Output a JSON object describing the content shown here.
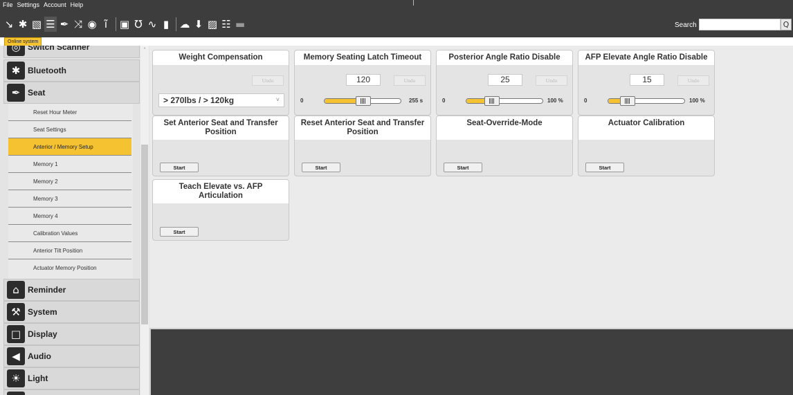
{
  "menu": [
    "File",
    "Settings",
    "Account",
    "Help"
  ],
  "toolbar_icons": [
    "scanner-icon",
    "bluetooth-icon",
    "seat-display-icon",
    "lines-icon",
    "seat-icon",
    "shuffle-icon",
    "camera-icon",
    "remote-icon",
    "monitor-icon",
    "stethoscope-icon",
    "pulse-icon",
    "battery-icon",
    "cloud-icon",
    "download-icon",
    "image-icon",
    "clipboard-icon",
    "chat-icon"
  ],
  "search": {
    "label": "Search",
    "value": "",
    "button": "Q"
  },
  "status": {
    "online_badge": "Online system"
  },
  "sidebar": {
    "categories": [
      {
        "label": "Switch Scanner",
        "icon": "scanner-icon"
      },
      {
        "label": "Bluetooth",
        "icon": "bluetooth-icon"
      },
      {
        "label": "Seat",
        "icon": "seat-icon"
      },
      {
        "label": "Reminder",
        "icon": "bell-icon"
      },
      {
        "label": "System",
        "icon": "wrench-icon"
      },
      {
        "label": "Display",
        "icon": "monitor-icon"
      },
      {
        "label": "Audio",
        "icon": "speaker-icon"
      },
      {
        "label": "Light",
        "icon": "lightbulb-icon"
      }
    ],
    "seat_items": [
      "Reset Hour Meter",
      "Seat Settings",
      "Anterior / Memory Setup",
      "Memory 1",
      "Memory 2",
      "Memory 3",
      "Memory 4",
      "Calibration Values",
      "Anterior Tilt Position",
      "Actuator Memory Position"
    ],
    "selected_item": "Anterior / Memory Setup"
  },
  "cards": {
    "weight": {
      "title": "Weight Compensation",
      "undo": "Undo",
      "select_value": "> 270lbs / > 120kg"
    },
    "latch": {
      "title": "Memory Seating Latch Timeout",
      "value": "120",
      "undo": "Undo",
      "min": "0",
      "max": "255 s",
      "level": 0.47
    },
    "posterior": {
      "title": "Posterior Angle Ratio Disable",
      "value": "25",
      "undo": "Undo",
      "min": "0",
      "max": "100 %",
      "level": 0.25
    },
    "afp": {
      "title": "AFP Elevate Angle Ratio Disable",
      "value": "15",
      "undo": "Undo",
      "min": "0",
      "max": "100 %",
      "level": 0.15
    },
    "set_anterior": {
      "title": "Set Anterior Seat and Transfer Position",
      "start": "Start"
    },
    "reset_anterior": {
      "title": "Reset Anterior Seat and Transfer Position",
      "start": "Start"
    },
    "override": {
      "title": "Seat-Override-Mode",
      "start": "Start"
    },
    "actuator": {
      "title": "Actuator Calibration",
      "start": "Start"
    },
    "teach": {
      "title": "Teach Elevate vs. AFP Articulation",
      "start": "Start"
    }
  }
}
